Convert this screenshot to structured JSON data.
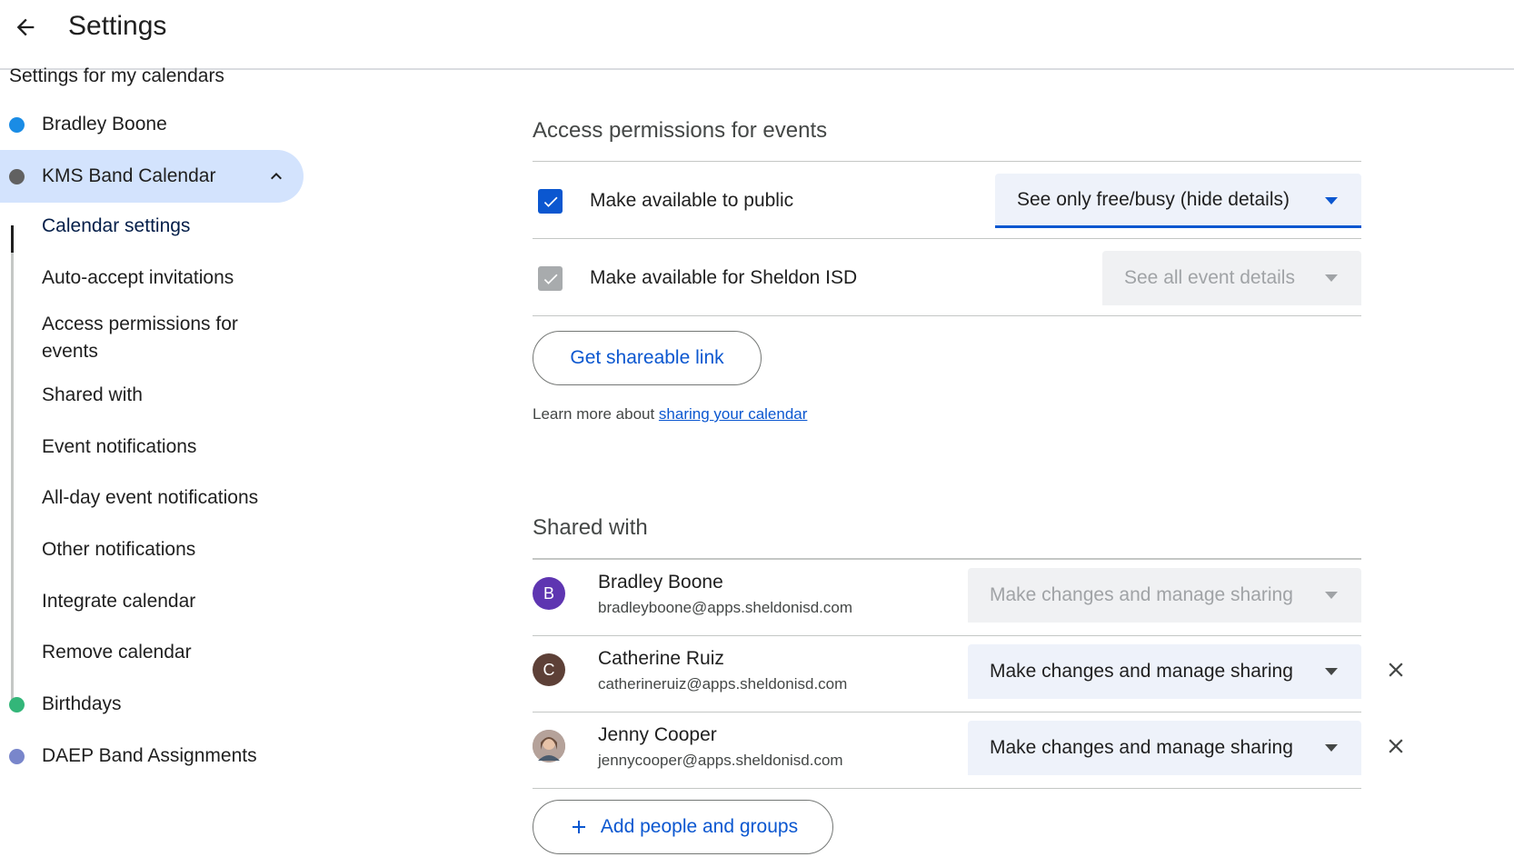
{
  "header": {
    "title": "Settings"
  },
  "sidebar": {
    "section_title": "Settings for my calendars",
    "calendars": [
      {
        "label": "Bradley Boone",
        "color": "#1a8ce5"
      },
      {
        "label": "KMS Band Calendar",
        "color": "#616161"
      },
      {
        "label": "Birthdays",
        "color": "#33b679"
      },
      {
        "label": "DAEP Band Assignments",
        "color": "#7986cb"
      }
    ],
    "sub_items": [
      "Calendar settings",
      "Auto-accept invitations",
      "Access permissions for events",
      "Shared with",
      "Event notifications",
      "All-day event notifications",
      "Other notifications",
      "Integrate calendar",
      "Remove calendar"
    ]
  },
  "access": {
    "title": "Access permissions for events",
    "public_label": "Make available to public",
    "public_select": "See only free/busy (hide details)",
    "org_label": "Make available for Sheldon ISD",
    "org_select": "See all event details",
    "shareable_link_label": "Get shareable link",
    "learn_prefix": "Learn more about ",
    "learn_link": "sharing your calendar"
  },
  "shared": {
    "title": "Shared with",
    "people": [
      {
        "name": "Bradley Boone",
        "email": "bradleyboone@apps.sheldonisd.com",
        "initial": "B",
        "avatar_color": "#5e35b1",
        "permission": "Make changes and manage sharing"
      },
      {
        "name": "Catherine Ruiz",
        "email": "catherineruiz@apps.sheldonisd.com",
        "initial": "C",
        "avatar_color": "#5d4037",
        "permission": "Make changes and manage sharing"
      },
      {
        "name": "Jenny Cooper",
        "email": "jennycooper@apps.sheldonisd.com",
        "initial": "",
        "avatar_color": "#8a7a78",
        "permission": "Make changes and manage sharing"
      }
    ],
    "add_label": "Add people and groups"
  }
}
